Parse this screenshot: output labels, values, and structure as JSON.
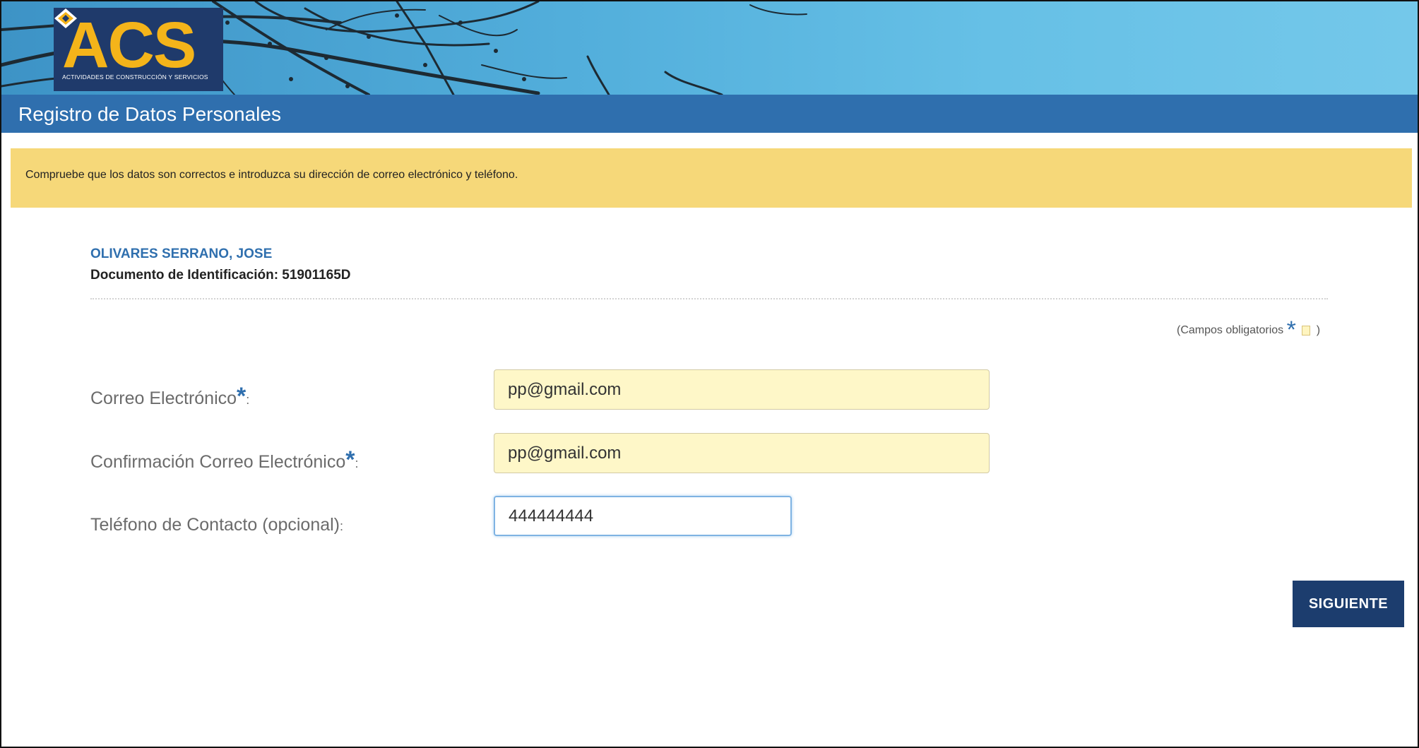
{
  "header": {
    "logo_text": "ACS",
    "logo_subtitle": "ACTIVIDADES DE CONSTRUCCIÓN Y SERVICIOS",
    "page_title": "Registro de Datos Personales"
  },
  "notice": {
    "text": "Compruebe que los datos son correctos e introduzca su dirección de correo electrónico y teléfono."
  },
  "person": {
    "name": "OLIVARES SERRANO, JOSE",
    "document_line": "Documento de Identificación: 51901165D"
  },
  "required_note": {
    "prefix": "(Campos obligatorios",
    "star": "*",
    "suffix": ")"
  },
  "form": {
    "email_label": "Correo Electrónico",
    "email_value": "pp@gmail.com",
    "confirm_label": "Confirmación Correo Electrónico",
    "confirm_value": "pp@gmail.com",
    "phone_label": "Teléfono de Contacto (opcional)",
    "phone_value": "444444444",
    "required_star": "*",
    "colon": ":"
  },
  "actions": {
    "next_label": "SIGUIENTE"
  },
  "colors": {
    "title_bar": "#2f6fae",
    "notice_bg": "#f6d879",
    "required_field_bg": "#fef7c8",
    "button_bg": "#1c3d6e",
    "accent_blue": "#2f6fae"
  }
}
